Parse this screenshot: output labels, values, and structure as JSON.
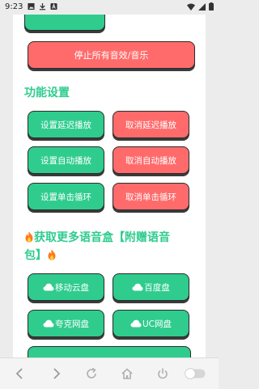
{
  "status_bar": {
    "time": "9:23",
    "left_icons": [
      "image-icon",
      "download-icon",
      "font-icon"
    ],
    "right_icons": [
      "wifi-icon",
      "signal-icon",
      "battery-icon"
    ]
  },
  "stop_all_label": "停止所有音效/音乐",
  "function_settings": {
    "title": "功能设置",
    "buttons": [
      {
        "label": "设置延迟播放",
        "color": "green"
      },
      {
        "label": "取消延迟播放",
        "color": "red"
      },
      {
        "label": "设置自动播放",
        "color": "green"
      },
      {
        "label": "取消自动播放",
        "color": "red"
      },
      {
        "label": "设置单击循环",
        "color": "green"
      },
      {
        "label": "取消单击循环",
        "color": "red"
      }
    ]
  },
  "more_section": {
    "title_line1": "获取更多语音盒【附赠语音",
    "title_line2": "包】",
    "icon": "fire-icon",
    "buttons": [
      {
        "label": "移动云盘"
      },
      {
        "label": "百度盘"
      },
      {
        "label": "夸克网盘"
      },
      {
        "label": "UC网盘"
      }
    ]
  },
  "colors": {
    "green": "#2fcc8e",
    "red": "#ff6b6b",
    "title_green": "#2fcc8e"
  },
  "bottom_nav": [
    "back-icon",
    "forward-icon",
    "refresh-icon",
    "home-icon",
    "power-icon",
    "toggle-icon"
  ]
}
